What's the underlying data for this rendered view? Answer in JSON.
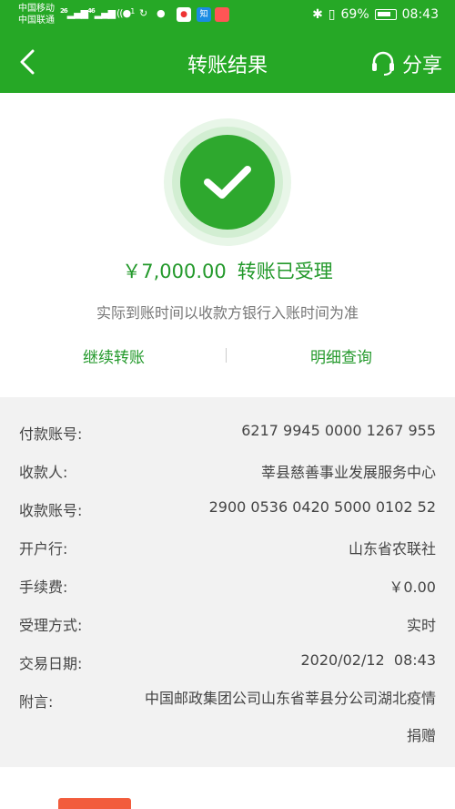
{
  "status_bar": {
    "carrier_1": "中国移动",
    "carrier_2": "中国联通",
    "signal_1": "26",
    "signal_2": "46",
    "notification_count": "1",
    "app_zhihu": "知",
    "battery": "69%",
    "time": "08:43"
  },
  "header": {
    "title": "转账结果",
    "share_label": "分享"
  },
  "result": {
    "amount": "￥7,000.00",
    "status": "转账已受理",
    "notice": "实际到账时间以收款方银行入账时间为准",
    "continue_label": "继续转账",
    "detail_label": "明细查询"
  },
  "details": [
    {
      "label": "付款账号:",
      "value": "6217 9945 0000 1267 955"
    },
    {
      "label": "收款人:",
      "value": "莘县慈善事业发展服务中心"
    },
    {
      "label": "收款账号:",
      "value": "2900 0536 0420 5000 0102 52"
    },
    {
      "label": "开户行:",
      "value": "山东省农联社"
    },
    {
      "label": "手续费:",
      "value": "￥0.00"
    },
    {
      "label": "受理方式:",
      "value": "实时"
    },
    {
      "label": "交易日期:",
      "value": "2020/02/12  08:43"
    },
    {
      "label": "附言:",
      "value": "中国邮政集团公司山东省莘县分公司湖北疫情捐赠"
    }
  ],
  "colors": {
    "brand_green": "#26a826",
    "success_green": "#2ea82e",
    "link_green": "#23992b"
  }
}
